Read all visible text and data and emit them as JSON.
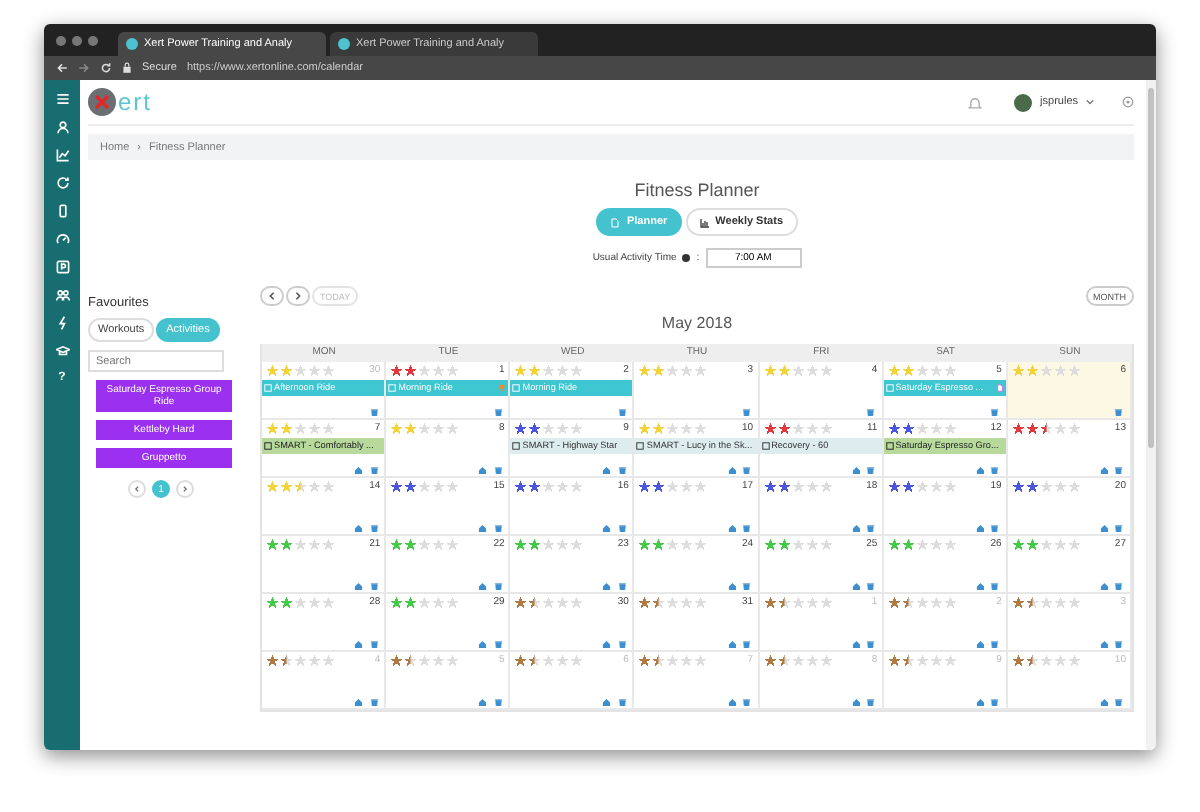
{
  "browser": {
    "tabs": [
      {
        "title": "Xert Power Training and Analy",
        "selected": true
      },
      {
        "title": "Xert Power Training and Analy",
        "selected": false
      }
    ],
    "secure": "Secure",
    "url": "https://www.xertonline.com/calendar"
  },
  "header": {
    "logo_text": "ert",
    "user": "jsprules"
  },
  "sidebar": {
    "help": "?"
  },
  "breadcrumb": {
    "items": [
      "Home",
      "Fitness Planner"
    ],
    "separator": "›"
  },
  "favourites": {
    "title": "Favourites",
    "tabs": [
      {
        "label": "Workouts",
        "selected": false
      },
      {
        "label": "Activities",
        "selected": true
      }
    ],
    "search": {
      "placeholder": "Search"
    },
    "items": [
      "Saturday Espresso Group Ride",
      "Kettleby Hard",
      "Gruppetto"
    ],
    "pages": [
      {
        "label": "1",
        "selected": true
      }
    ]
  },
  "planner": {
    "title": "Fitness Planner",
    "views": [
      {
        "label": "Planner",
        "selected": true
      },
      {
        "label": "Weekly Stats",
        "selected": false
      }
    ],
    "time_label": "Usual Activity Time",
    "time_colon": ":",
    "time_value": "7:00 AM",
    "today": {
      "label": "TODAY",
      "disabled": true
    },
    "view_button": "MONTH",
    "month": "May 2018"
  },
  "calendar": {
    "weekdays": [
      "MON",
      "TUE",
      "WED",
      "THU",
      "FRI",
      "SAT",
      "SUN"
    ],
    "weeks": [
      {
        "days": [
          {
            "day": "30",
            "other_month": true,
            "today": false,
            "stars": 2,
            "color": "#f2d43a",
            "home_icon": false,
            "event": {
              "kind": "activity",
              "label": "Afternoon Ride",
              "trophy": false,
              "note": false
            }
          },
          {
            "day": "1",
            "other_month": false,
            "today": false,
            "stars": 2,
            "color": "#e0393e",
            "home_icon": false,
            "event": {
              "kind": "activity",
              "label": "Morning Ride",
              "trophy": true,
              "note": false
            }
          },
          {
            "day": "2",
            "other_month": false,
            "today": false,
            "stars": 2,
            "color": "#f2d43a",
            "home_icon": false,
            "event": {
              "kind": "activity",
              "label": "Morning Ride",
              "trophy": false,
              "note": false
            }
          },
          {
            "day": "3",
            "other_month": false,
            "today": false,
            "stars": 2,
            "color": "#f2d43a",
            "home_icon": false
          },
          {
            "day": "4",
            "other_month": false,
            "today": false,
            "stars": 2,
            "color": "#f2d43a",
            "home_icon": false
          },
          {
            "day": "5",
            "other_month": false,
            "today": false,
            "stars": 2,
            "color": "#f2d43a",
            "home_icon": false,
            "event": {
              "kind": "activity",
              "label": "Saturday Espresso ...",
              "trophy": false,
              "note": true
            }
          },
          {
            "day": "6",
            "other_month": false,
            "today": true,
            "stars": 2,
            "color": "#f2d43a",
            "home_icon": false
          }
        ]
      },
      {
        "days": [
          {
            "day": "7",
            "other_month": false,
            "today": false,
            "stars": 2,
            "color": "#f2d43a",
            "home_icon": true,
            "event": {
              "kind": "done",
              "label": "SMART - Comfortably ...",
              "trophy": false,
              "note": false
            }
          },
          {
            "day": "8",
            "other_month": false,
            "today": false,
            "stars": 2,
            "color": "#f2d43a",
            "home_icon": true
          },
          {
            "day": "9",
            "other_month": false,
            "today": false,
            "stars": 2,
            "color": "#4b55e0",
            "home_icon": true,
            "event": {
              "kind": "planned",
              "label": "SMART - Highway Star",
              "trophy": false,
              "note": false
            }
          },
          {
            "day": "10",
            "other_month": false,
            "today": false,
            "stars": 2,
            "color": "#f2d43a",
            "home_icon": true,
            "event": {
              "kind": "planned",
              "label": "SMART - Lucy in the Sk...",
              "trophy": false,
              "note": false
            }
          },
          {
            "day": "11",
            "other_month": false,
            "today": false,
            "stars": 2,
            "color": "#e0393e",
            "home_icon": true,
            "event": {
              "kind": "planned",
              "label": "Recovery - 60",
              "trophy": false,
              "note": false
            }
          },
          {
            "day": "12",
            "other_month": false,
            "today": false,
            "stars": 2,
            "color": "#4b55e0",
            "home_icon": true,
            "event": {
              "kind": "done",
              "label": "Saturday Espresso Gro...",
              "trophy": false,
              "note": false
            }
          },
          {
            "day": "13",
            "other_month": false,
            "today": false,
            "stars": 2.5,
            "color": "#e0393e",
            "home_icon": true
          }
        ]
      },
      {
        "days": [
          {
            "day": "14",
            "other_month": false,
            "today": false,
            "stars": 2.5,
            "color": "#f2d43a",
            "home_icon": true
          },
          {
            "day": "15",
            "other_month": false,
            "today": false,
            "stars": 2,
            "color": "#4b55e0",
            "home_icon": true
          },
          {
            "day": "16",
            "other_month": false,
            "today": false,
            "stars": 2,
            "color": "#4b55e0",
            "home_icon": true
          },
          {
            "day": "17",
            "other_month": false,
            "today": false,
            "stars": 2,
            "color": "#4b55e0",
            "home_icon": true
          },
          {
            "day": "18",
            "other_month": false,
            "today": false,
            "stars": 2,
            "color": "#4b55e0",
            "home_icon": true
          },
          {
            "day": "19",
            "other_month": false,
            "today": false,
            "stars": 2,
            "color": "#4b55e0",
            "home_icon": true
          },
          {
            "day": "20",
            "other_month": false,
            "today": false,
            "stars": 2,
            "color": "#4b55e0",
            "home_icon": true
          }
        ]
      },
      {
        "days": [
          {
            "day": "21",
            "other_month": false,
            "today": false,
            "stars": 2,
            "color": "#45c948",
            "home_icon": true
          },
          {
            "day": "22",
            "other_month": false,
            "today": false,
            "stars": 2,
            "color": "#45c948",
            "home_icon": true
          },
          {
            "day": "23",
            "other_month": false,
            "today": false,
            "stars": 2,
            "color": "#45c948",
            "home_icon": true
          },
          {
            "day": "24",
            "other_month": false,
            "today": false,
            "stars": 2,
            "color": "#45c948",
            "home_icon": true
          },
          {
            "day": "25",
            "other_month": false,
            "today": false,
            "stars": 2,
            "color": "#45c948",
            "home_icon": true
          },
          {
            "day": "26",
            "other_month": false,
            "today": false,
            "stars": 2,
            "color": "#45c948",
            "home_icon": true
          },
          {
            "day": "27",
            "other_month": false,
            "today": false,
            "stars": 2,
            "color": "#45c948",
            "home_icon": true
          }
        ]
      },
      {
        "days": [
          {
            "day": "28",
            "other_month": false,
            "today": false,
            "stars": 2,
            "color": "#45c948",
            "home_icon": true
          },
          {
            "day": "29",
            "other_month": false,
            "today": false,
            "stars": 2,
            "color": "#45c948",
            "home_icon": true
          },
          {
            "day": "30",
            "other_month": false,
            "today": false,
            "stars": 1.5,
            "color": "#b07a45",
            "home_icon": true
          },
          {
            "day": "31",
            "other_month": false,
            "today": false,
            "stars": 1.5,
            "color": "#b07a45",
            "home_icon": true
          },
          {
            "day": "1",
            "other_month": true,
            "today": false,
            "stars": 1.5,
            "color": "#b07a45",
            "home_icon": true
          },
          {
            "day": "2",
            "other_month": true,
            "today": false,
            "stars": 1.5,
            "color": "#b07a45",
            "home_icon": true
          },
          {
            "day": "3",
            "other_month": true,
            "today": false,
            "stars": 1.5,
            "color": "#b07a45",
            "home_icon": true
          }
        ]
      },
      {
        "days": [
          {
            "day": "4",
            "other_month": true,
            "today": false,
            "stars": 1.5,
            "color": "#b07a45",
            "home_icon": true
          },
          {
            "day": "5",
            "other_month": true,
            "today": false,
            "stars": 1.5,
            "color": "#b07a45",
            "home_icon": true
          },
          {
            "day": "6",
            "other_month": true,
            "today": false,
            "stars": 1.5,
            "color": "#b07a45",
            "home_icon": true
          },
          {
            "day": "7",
            "other_month": true,
            "today": false,
            "stars": 1.5,
            "color": "#b07a45",
            "home_icon": true
          },
          {
            "day": "8",
            "other_month": true,
            "today": false,
            "stars": 1.5,
            "color": "#b07a45",
            "home_icon": true
          },
          {
            "day": "9",
            "other_month": true,
            "today": false,
            "stars": 1.5,
            "color": "#b07a45",
            "home_icon": true
          },
          {
            "day": "10",
            "other_month": true,
            "today": false,
            "stars": 1.5,
            "color": "#b07a45",
            "home_icon": true
          }
        ]
      }
    ]
  }
}
